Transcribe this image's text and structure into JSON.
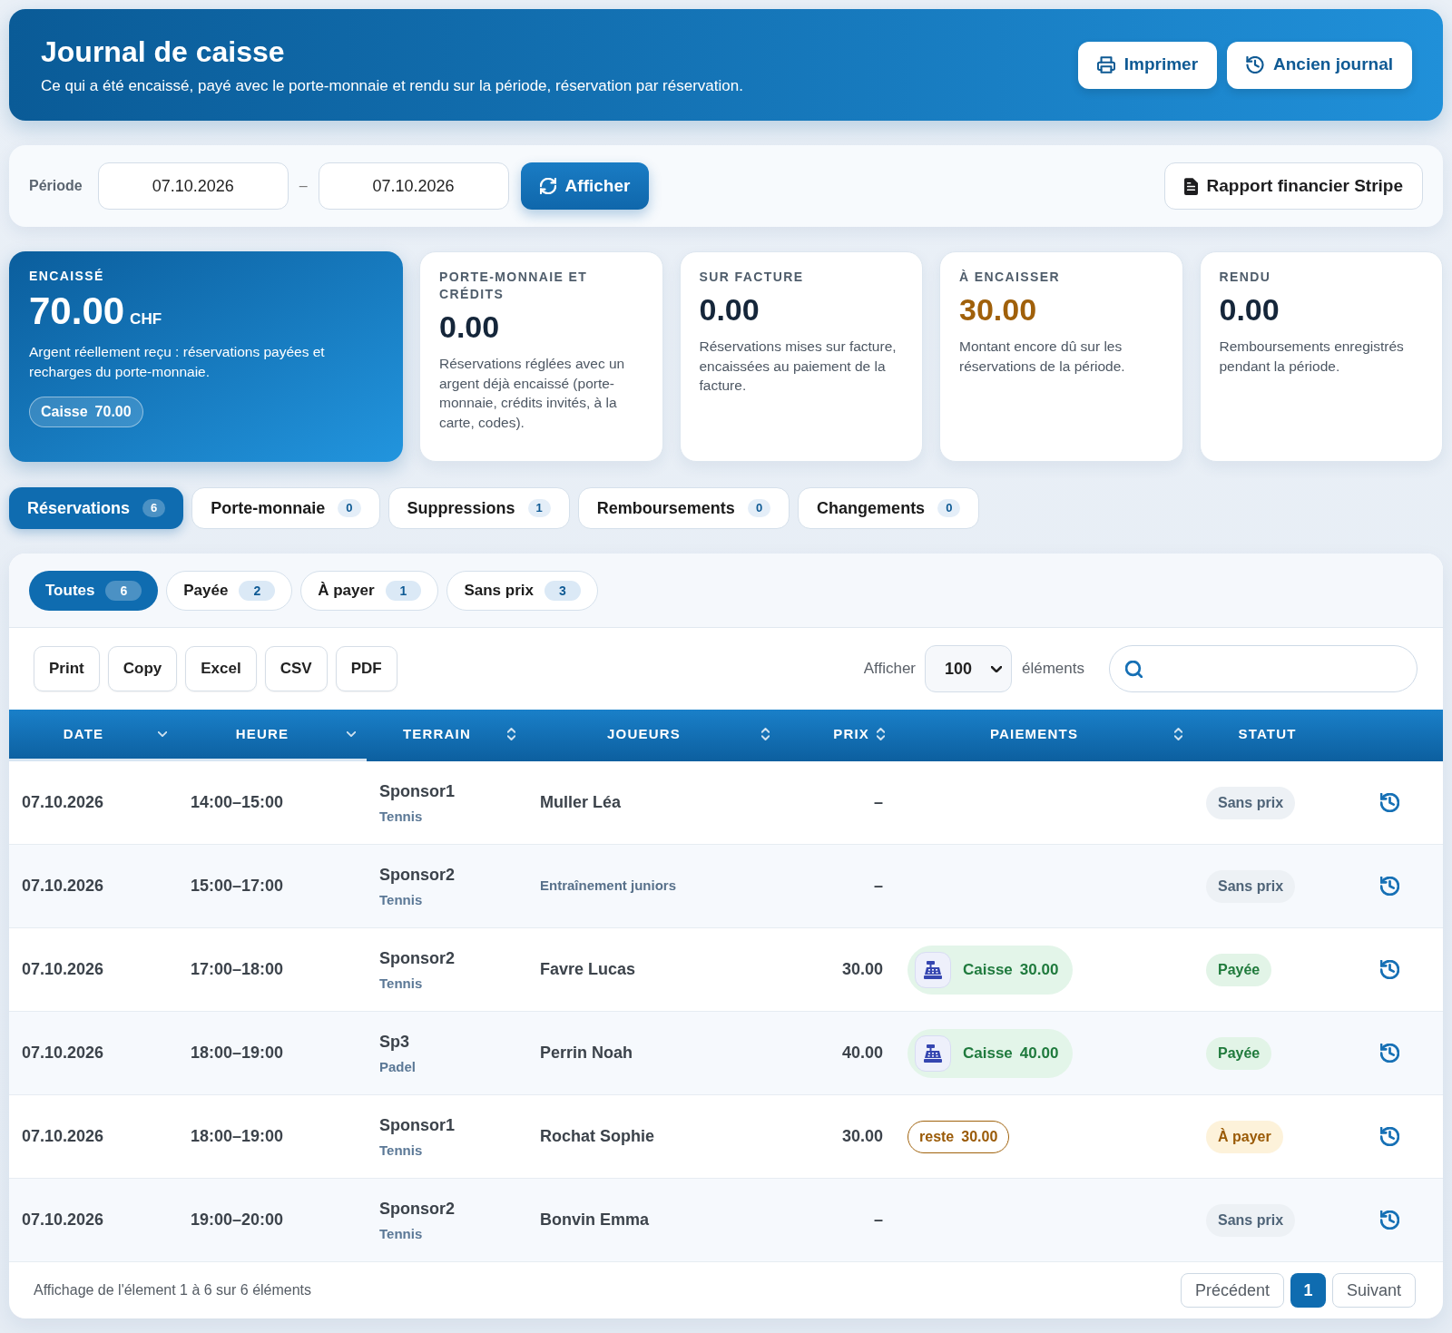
{
  "header": {
    "title": "Journal de caisse",
    "subtitle": "Ce qui a été encaissé, payé avec le porte-monnaie et rendu sur la période, réservation par réservation.",
    "buttons": [
      {
        "label": "Imprimer",
        "kind": "print"
      },
      {
        "label": "Ancien journal",
        "kind": "history"
      }
    ]
  },
  "period": {
    "label": "Période",
    "from": "07.10.2026",
    "separator": "–",
    "to": "07.10.2026",
    "submit": "Afficher",
    "report_button": "Rapport financier Stripe"
  },
  "summary_cards": [
    {
      "kind": "primary",
      "label": "ENCAISSÉ",
      "value": "70.00",
      "unit": "CHF",
      "description": "Argent réellement reçu : réservations payées et recharges du porte-monnaie.",
      "badge": {
        "label": "Caisse",
        "amount": "70.00"
      }
    },
    {
      "kind": "plain",
      "label": "PORTE-MONNAIE ET CRÉDITS",
      "value": "0.00",
      "description": "Réservations réglées avec un argent déjà encaissé (porte-monnaie, crédits invités, à la carte, codes)."
    },
    {
      "kind": "plain",
      "label": "SUR FACTURE",
      "value": "0.00",
      "description": "Réservations mises sur facture, encaissées au paiement de la facture."
    },
    {
      "kind": "due",
      "label": "À ENCAISSER",
      "value": "30.00",
      "description": "Montant encore dû sur les réservations de la période."
    },
    {
      "kind": "plain",
      "label": "RENDU",
      "value": "0.00",
      "description": "Remboursements enregistrés pendant la période."
    }
  ],
  "tabs": [
    {
      "label": "Réservations",
      "count": "6",
      "selected": true
    },
    {
      "label": "Porte-monnaie",
      "count": "0",
      "selected": false
    },
    {
      "label": "Suppressions",
      "count": "1",
      "selected": false
    },
    {
      "label": "Remboursements",
      "count": "0",
      "selected": false
    },
    {
      "label": "Changements",
      "count": "0",
      "selected": false
    }
  ],
  "filters": [
    {
      "label": "Toutes",
      "count": "6",
      "selected": true
    },
    {
      "label": "Payée",
      "count": "2",
      "selected": false
    },
    {
      "label": "À payer",
      "count": "1",
      "selected": false
    },
    {
      "label": "Sans prix",
      "count": "3",
      "selected": false
    }
  ],
  "export_buttons": [
    "Print",
    "Copy",
    "Excel",
    "CSV",
    "PDF"
  ],
  "page_length": {
    "label": "Afficher",
    "value": "100",
    "suffix": "éléments"
  },
  "table": {
    "columns": [
      {
        "label": "DATE",
        "sortable": true,
        "sorted": true
      },
      {
        "label": "HEURE",
        "sortable": true,
        "sorted": true
      },
      {
        "label": "TERRAIN",
        "sortable": true,
        "sorted": false
      },
      {
        "label": "JOUEURS",
        "sortable": true,
        "sorted": false
      },
      {
        "label": "PRIX",
        "sortable": true,
        "sorted": false
      },
      {
        "label": "PAIEMENTS",
        "sortable": true,
        "sorted": false
      },
      {
        "label": "STATUT",
        "sortable": false,
        "sorted": false
      }
    ],
    "rows": [
      {
        "date": "07.10.2026",
        "time": "14:00–15:00",
        "court": "Sponsor1",
        "sport": "Tennis",
        "players": {
          "kind": "person",
          "text": "Muller Léa"
        },
        "price": "–",
        "status": {
          "kind": "none",
          "label": "Sans prix"
        }
      },
      {
        "date": "07.10.2026",
        "time": "15:00–17:00",
        "court": "Sponsor2",
        "sport": "Tennis",
        "players": {
          "kind": "group",
          "text": "Entraînement juniors"
        },
        "price": "–",
        "status": {
          "kind": "none",
          "label": "Sans prix"
        }
      },
      {
        "date": "07.10.2026",
        "time": "17:00–18:00",
        "court": "Sponsor2",
        "sport": "Tennis",
        "players": {
          "kind": "person",
          "text": "Favre Lucas"
        },
        "price": "30.00",
        "payments": [
          {
            "kind": "cash",
            "label": "Caisse",
            "amount": "30.00"
          }
        ],
        "status": {
          "kind": "paid",
          "label": "Payée"
        }
      },
      {
        "date": "07.10.2026",
        "time": "18:00–19:00",
        "court": "Sp3",
        "sport": "Padel",
        "players": {
          "kind": "person",
          "text": "Perrin Noah"
        },
        "price": "40.00",
        "payments": [
          {
            "kind": "cash",
            "label": "Caisse",
            "amount": "40.00"
          }
        ],
        "status": {
          "kind": "paid",
          "label": "Payée"
        }
      },
      {
        "date": "07.10.2026",
        "time": "18:00–19:00",
        "court": "Sponsor1",
        "sport": "Tennis",
        "players": {
          "kind": "person",
          "text": "Rochat Sophie"
        },
        "price": "30.00",
        "payments": [
          {
            "kind": "remaining",
            "label": "reste",
            "amount": "30.00"
          }
        ],
        "status": {
          "kind": "due",
          "label": "À payer"
        }
      },
      {
        "date": "07.10.2026",
        "time": "19:00–20:00",
        "court": "Sponsor2",
        "sport": "Tennis",
        "players": {
          "kind": "person",
          "text": "Bonvin Emma"
        },
        "price": "–",
        "status": {
          "kind": "none",
          "label": "Sans prix"
        }
      }
    ]
  },
  "footer": {
    "info": "Affichage de l'élement 1 à 6 sur 6 éléments",
    "previous": "Précédent",
    "pages": [
      {
        "label": "1",
        "selected": true
      }
    ],
    "next": "Suivant"
  }
}
